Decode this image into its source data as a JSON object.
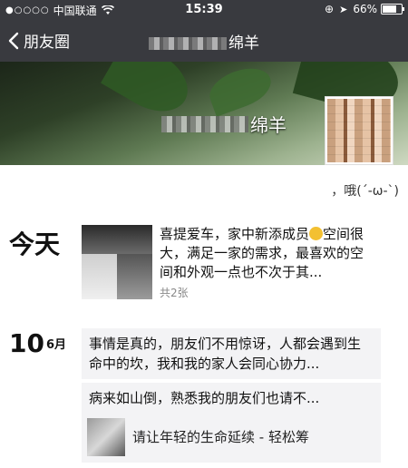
{
  "status_bar": {
    "signal_dots": "●○○○○",
    "carrier": "中国联通",
    "time": "15:39",
    "battery": "66%",
    "battery_level": 0.66,
    "icons": [
      "wifi-icon",
      "rotation-lock-icon",
      "location-arrow-icon",
      "battery-icon"
    ]
  },
  "nav": {
    "back_label": "朋友圈",
    "title_visible": "绵羊"
  },
  "profile": {
    "name_visible": "绵羊",
    "signature": "，哦(´-ω-`)"
  },
  "feed": {
    "group1": {
      "date": "今天",
      "post": {
        "text_before_emoji": "喜提爱车，家中新添成员",
        "text_after_emoji": "空间很大，满足一家的需求，最喜欢的空间和外观一点也不次于其...",
        "count": "共2张"
      }
    },
    "group2": {
      "day": "10",
      "month": "6月",
      "post1_text": "事情是真的，朋友们不用惊讶，人都会遇到生命中的坎，我和我的家人会同心协力...",
      "post2_text": "病来如山倒，熟悉我的朋友们也请不...",
      "post2_share_title": "请让年轻的生命延续 - 轻松筹"
    }
  },
  "colors": {
    "nav_bg": "#393a3f",
    "feed_card_bg": "#f3f3f5"
  }
}
